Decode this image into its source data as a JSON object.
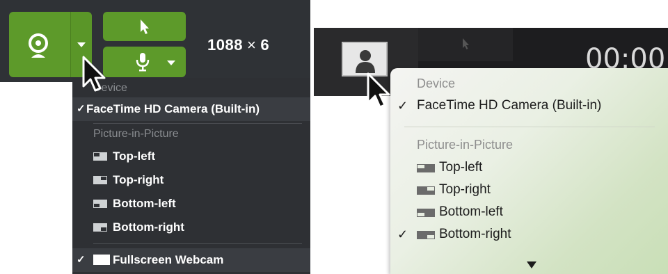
{
  "left": {
    "resolution": {
      "width": "1088",
      "times": "×",
      "height": "6"
    },
    "menu": {
      "device_header": "Device",
      "device": "FaceTime HD Camera (Built-in)",
      "device_check": "✓",
      "pip_header": "Picture-in-Picture",
      "pip_items": [
        "Top-left",
        "Top-right",
        "Bottom-left",
        "Bottom-right"
      ],
      "fullscreen": "Fullscreen Webcam",
      "fullscreen_check": "✓"
    }
  },
  "right": {
    "timer": "00:00",
    "menu": {
      "device_header": "Device",
      "device": "FaceTime HD Camera (Built-in)",
      "device_check": "✓",
      "pip_header": "Picture-in-Picture",
      "pip_items": [
        "Top-left",
        "Top-right",
        "Bottom-left",
        "Bottom-right"
      ],
      "selected_check": "✓"
    }
  },
  "colors": {
    "accent_green": "#5d9a2a",
    "dark_toolbar": "#2f3236",
    "menu_dark": "#2e3034"
  },
  "icons": [
    "webcam-icon",
    "pointer-icon",
    "microphone-icon",
    "chevron-down-icon",
    "person-icon",
    "pip-layout-icon",
    "fullscreen-icon"
  ]
}
